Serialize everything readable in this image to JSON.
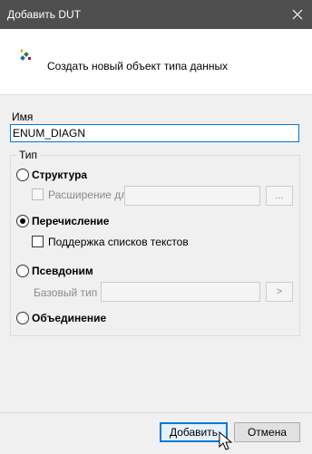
{
  "window": {
    "title": "Добавить DUT"
  },
  "header": {
    "icon": "dut-icon",
    "text": "Создать новый объект типа данных"
  },
  "name": {
    "label": "Имя",
    "value": "ENUM_DIAGN"
  },
  "type_group": {
    "legend": "Тип",
    "options": [
      {
        "label": "Структура",
        "checked": false
      },
      {
        "label": "Перечисление",
        "checked": true
      },
      {
        "label": "Псевдоним",
        "checked": false
      },
      {
        "label": "Объединение",
        "checked": false
      }
    ],
    "extends_label": "Расширение для",
    "extends_browse": "...",
    "text_list_support": "Поддержка списков текстов",
    "base_type_label": "Базовый тип",
    "base_type_browse": ">"
  },
  "buttons": {
    "add": "Добавить",
    "cancel": "Отмена"
  },
  "colors": {
    "titlebar": "#4f4f4f",
    "accent": "#0078d7"
  }
}
